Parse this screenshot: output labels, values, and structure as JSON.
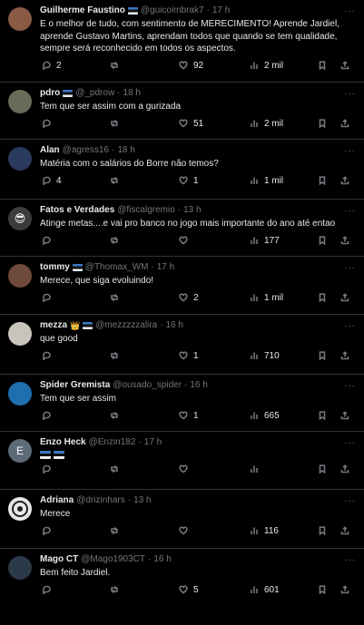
{
  "tweets": [
    {
      "name": "Guilherme Faustino",
      "flag": true,
      "handle": "@guicoimbrak7",
      "time": "17 h",
      "text": "E o melhor de tudo, com sentimento de MERECIMENTO! Aprende Jardiel, aprende Gustavo Martins, aprendam todos que quando se tem qualidade, sempre será reconhecido em todos os aspectos.",
      "replies": "2",
      "retweets": "",
      "likes": "92",
      "views": "2 mil",
      "avatar_color": "#8a5a44"
    },
    {
      "name": "pdro",
      "flag": true,
      "handle": "@_pdrow",
      "time": "18 h",
      "text": "Tem que ser assim com a gurizada",
      "replies": "",
      "retweets": "",
      "likes": "51",
      "views": "2 mil",
      "avatar_color": "#6b6b5a"
    },
    {
      "name": "Alan",
      "flag": false,
      "handle": "@agress16",
      "time": "18 h",
      "text": "Matéria com o salários do Borre não temos?",
      "replies": "4",
      "retweets": "",
      "likes": "1",
      "views": "1 mil",
      "avatar_color": "#2a3a5c"
    },
    {
      "name": "Fatos e Verdades",
      "flag": false,
      "handle": "@fiscalgremio",
      "time": "13 h",
      "text": "Atinge metas....e vai pro banco no jogo mais importante do ano até entao",
      "replies": "",
      "retweets": "",
      "likes": "",
      "views": "177",
      "avatar_color": "#3c3c3c"
    },
    {
      "name": "tommy",
      "flag": true,
      "handle": "@Thomax_WM",
      "time": "17 h",
      "text": "Merece, que siga evoluindo!",
      "replies": "",
      "retweets": "",
      "likes": "2",
      "views": "1 mil",
      "avatar_color": "#6e4a3a"
    },
    {
      "name": "mezza",
      "flag": true,
      "handle": "@mezzzzzalira",
      "time": "16 h",
      "text": "que good",
      "replies": "",
      "retweets": "",
      "likes": "1",
      "views": "710",
      "avatar_color": "#c9c4bb"
    },
    {
      "name": "Spider Gremista",
      "flag": false,
      "handle": "@ousado_spider",
      "time": "16 h",
      "text": "Tem que ser assim",
      "replies": "",
      "retweets": "",
      "likes": "1",
      "views": "665",
      "avatar_color": "#1f6fae"
    },
    {
      "name": "Enzo Heck",
      "flag": false,
      "handle": "@Enzin182",
      "time": "17 h",
      "text": "",
      "replies": "",
      "retweets": "",
      "likes": "",
      "views": "",
      "avatar_color": "#5d6a78",
      "avatar_letter": "E"
    },
    {
      "name": "Adriana",
      "flag": false,
      "handle": "@drizinhars",
      "time": "13 h",
      "text": "Merece",
      "replies": "",
      "retweets": "",
      "likes": "",
      "views": "116",
      "avatar_color": "#e8e8e8"
    },
    {
      "name": "Mago CT",
      "flag": false,
      "handle": "@Mago1903CT",
      "time": "16 h",
      "text": "Bem feito Jardiel.",
      "replies": "",
      "retweets": "",
      "likes": "5",
      "views": "601",
      "avatar_color": "#2b3a48"
    }
  ]
}
